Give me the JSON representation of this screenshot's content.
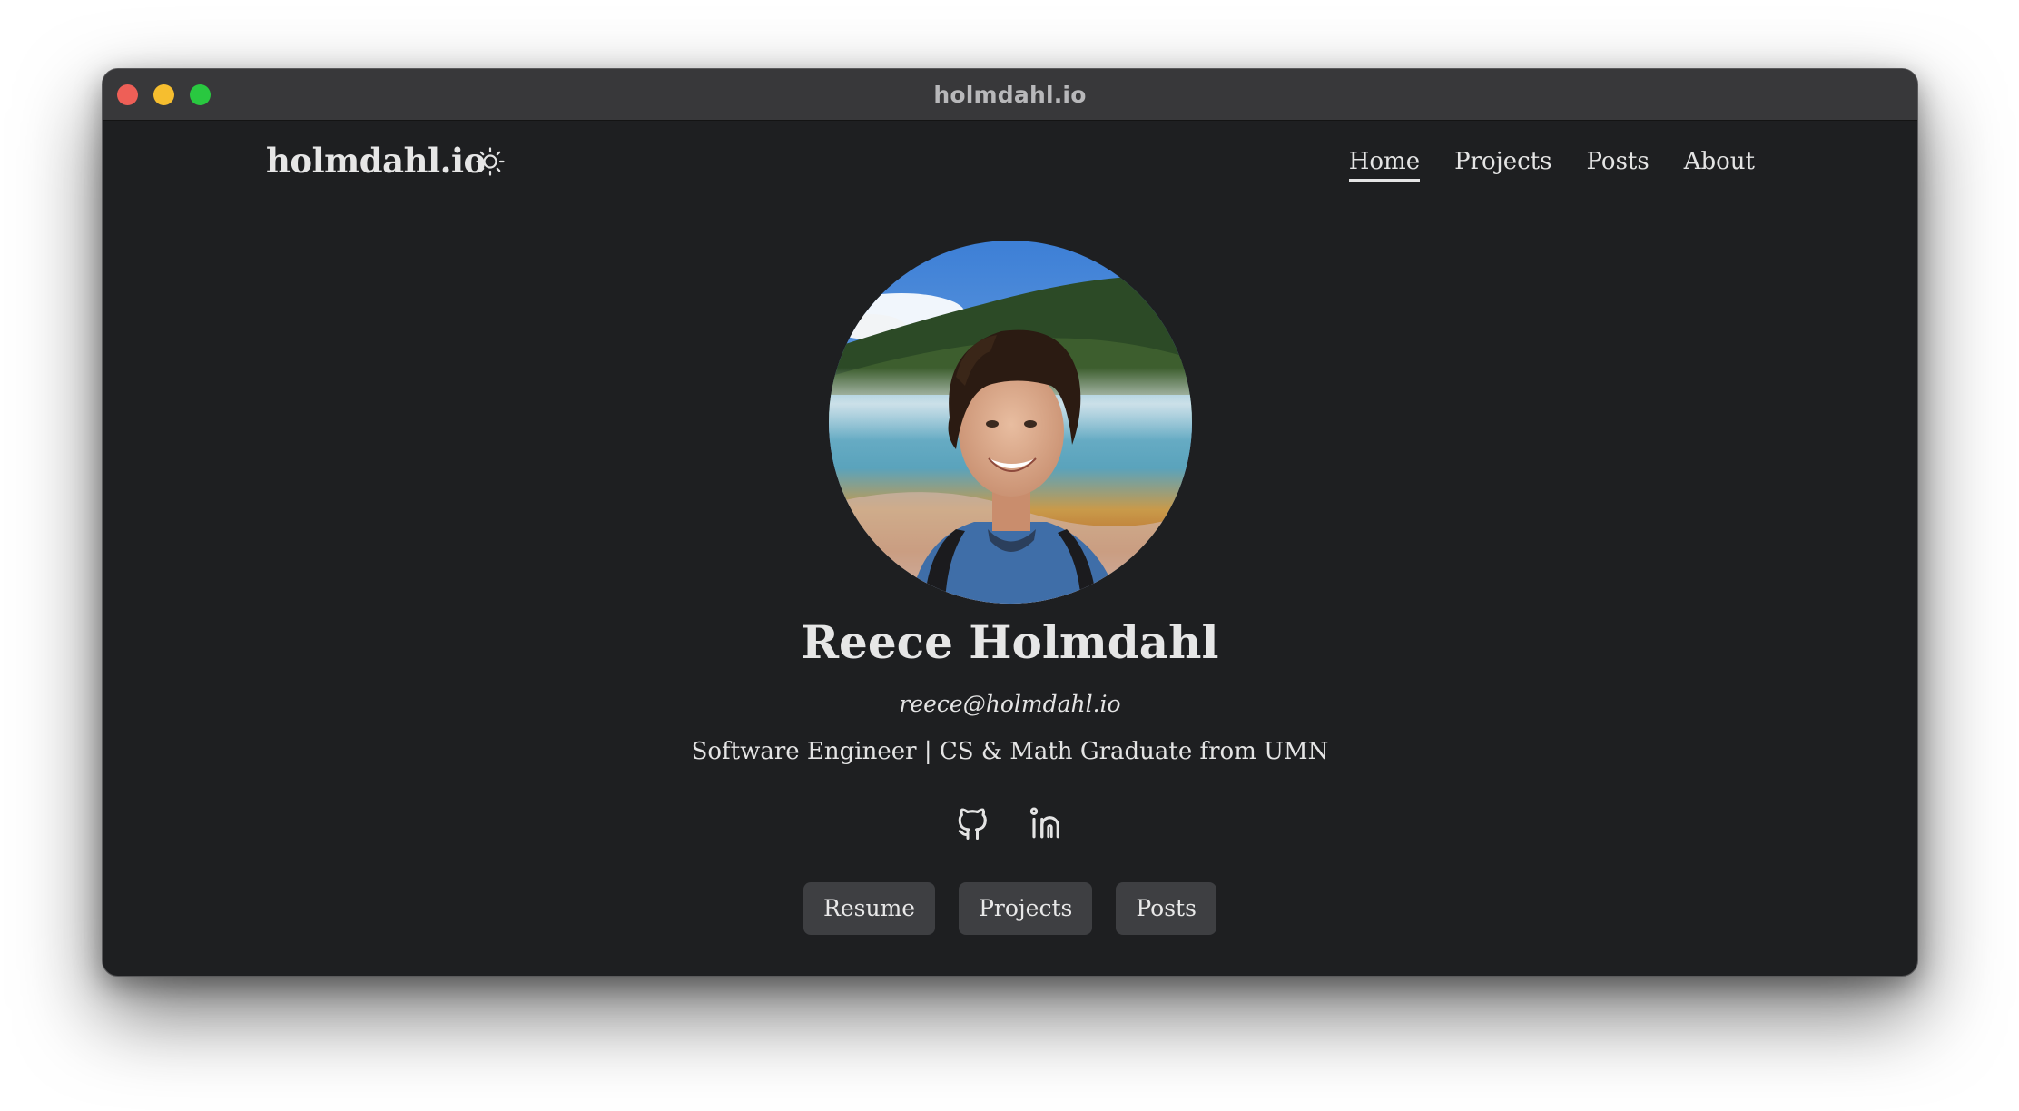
{
  "window": {
    "title": "holmdahl.io"
  },
  "header": {
    "brand": "holmdahl.io",
    "theme_toggle_icon": "sun-icon",
    "nav": [
      {
        "label": "Home",
        "active": true
      },
      {
        "label": "Projects",
        "active": false
      },
      {
        "label": "Posts",
        "active": false
      },
      {
        "label": "About",
        "active": false
      }
    ]
  },
  "profile": {
    "photo_icon": "profile-photo",
    "name": "Reece Holmdahl",
    "email": "reece@holmdahl.io",
    "tagline": "Software Engineer | CS & Math Graduate from UMN",
    "social": [
      {
        "icon": "github-icon"
      },
      {
        "icon": "linkedin-icon"
      }
    ],
    "buttons": [
      {
        "label": "Resume"
      },
      {
        "label": "Projects"
      },
      {
        "label": "Posts"
      }
    ]
  },
  "colors": {
    "background": "#1e1f21",
    "titlebar": "#38383a",
    "text": "#e4e4e4",
    "button": "#3e3f42",
    "close": "#ee5f57",
    "minimize": "#f6be2f",
    "maximize": "#29c840"
  }
}
